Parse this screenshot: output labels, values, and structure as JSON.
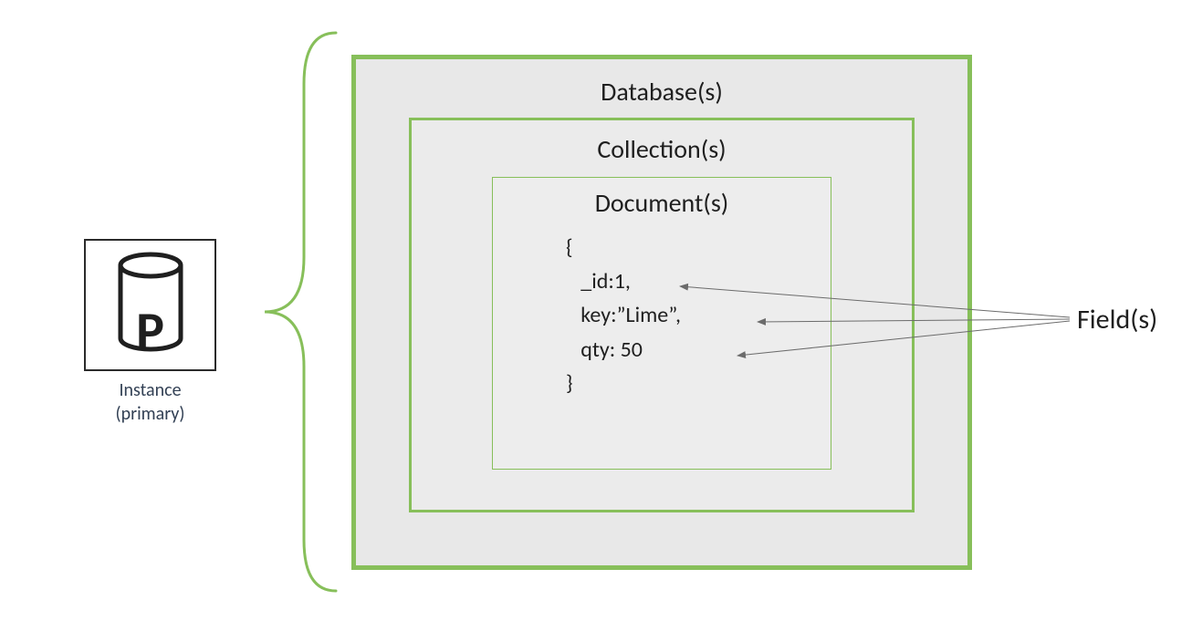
{
  "instance": {
    "letter": "P",
    "label_line1": "Instance",
    "label_line2": "(primary)"
  },
  "boxes": {
    "database_label": "Database(s)",
    "collection_label": "Collection(s)",
    "document_label": "Document(s)"
  },
  "document_content": {
    "open": "{",
    "line1": "   _id:1,",
    "line2": "   key:”Lime”,",
    "line3": "   qty: 50",
    "close": "}"
  },
  "fields_label": "Field(s)"
}
